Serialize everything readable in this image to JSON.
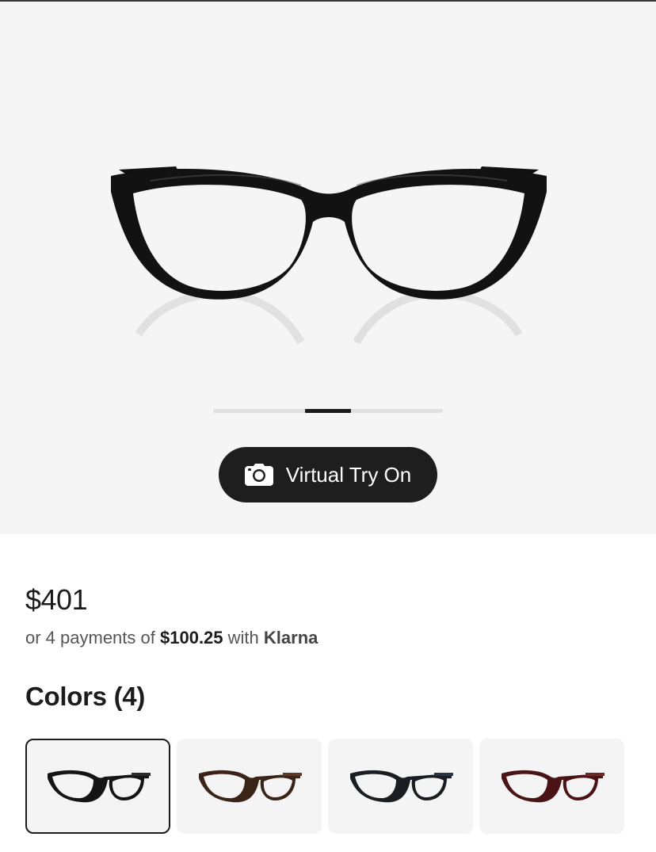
{
  "product": {
    "image_alt": "Black cat-eye eyeglasses",
    "carousel": {
      "slide_count": 5,
      "active_index": 2
    }
  },
  "virtual_try_on": {
    "label": "Virtual Try On",
    "icon": "camera-icon"
  },
  "pricing": {
    "price": "$401",
    "installment_prefix": "or 4 payments of",
    "installment_amount": "$100.25",
    "installment_mid": "with",
    "installment_provider": "Klarna"
  },
  "colors": {
    "title": "Colors (4)",
    "selected_index": 0,
    "options": [
      {
        "name": "black-frame-swatch",
        "frame_color": "#141414",
        "temple_color": "#2a2a2a"
      },
      {
        "name": "tortoise-frame-swatch",
        "frame_color": "#3a2418",
        "temple_color": "#5a3a26"
      },
      {
        "name": "black-blue-frame-swatch",
        "frame_color": "#1a1d22",
        "temple_color": "#2b3340"
      },
      {
        "name": "burgundy-frame-swatch",
        "frame_color": "#4a1416",
        "temple_color": "#6b2a22"
      }
    ]
  },
  "theme": {
    "accent": "#1e1e1e",
    "hero_bg": "#f5f5f5",
    "tiffany_blue": "#81d8d0"
  }
}
